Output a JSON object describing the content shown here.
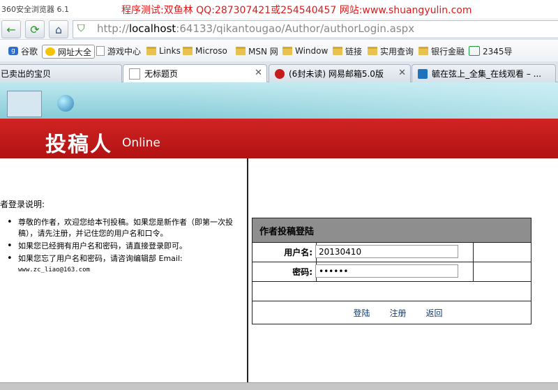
{
  "browser": {
    "app_name": "360安全浏览器 6.1",
    "banner": "程序测试:双鱼林 QQ:287307421或254540457 网站:www.shuangyulin.com"
  },
  "address": {
    "host": "localhost",
    "rest": ":64133/qikantougao/Author/authorLogin.aspx",
    "prefix": "http://"
  },
  "bookmarks": [
    {
      "label": "谷歌",
      "icon": "google-icon"
    },
    {
      "label": "网址大全",
      "icon": "site-dir-icon"
    },
    {
      "label": "游戏中心",
      "icon": "doc-icon"
    },
    {
      "label": "Links",
      "icon": "folder-icon"
    },
    {
      "label": "Microso",
      "icon": "folder-icon"
    },
    {
      "label": "MSN 网",
      "icon": "folder-icon"
    },
    {
      "label": "Window",
      "icon": "folder-icon"
    },
    {
      "label": "链接",
      "icon": "folder-icon"
    },
    {
      "label": "实用查询",
      "icon": "folder-icon"
    },
    {
      "label": "银行金融",
      "icon": "folder-icon"
    },
    {
      "label": "2345导",
      "icon": "2345-icon"
    }
  ],
  "tabs": [
    {
      "label": "已卖出的宝贝"
    },
    {
      "label": "无标题页"
    },
    {
      "label": "(6封未读) 网易邮箱5.0版"
    },
    {
      "label": "毓在弦上_全集_在线观看 – ..."
    }
  ],
  "page": {
    "logo_cn": "投稿人",
    "logo_en": "Online",
    "instructions_title": "者登录说明:",
    "instructions": [
      "尊敬的作者，欢迎您给本刊投稿。如果您是新作者（即第一次投稿），请先注册，并记住您的用户名和口令。",
      "如果您已经拥有用户名和密码，请直接登录即可。",
      "如果您忘了用户名和密码，请咨询编辑部 Email:"
    ],
    "email": "www.zc_liao@163.com",
    "login": {
      "title": "作者投稿登陆",
      "username_label": "用户名:",
      "username_value": "20130410",
      "password_label": "密码:",
      "password_value": "••••••",
      "login_link": "登陆",
      "register_link": "注册",
      "back_link": "返回"
    }
  }
}
